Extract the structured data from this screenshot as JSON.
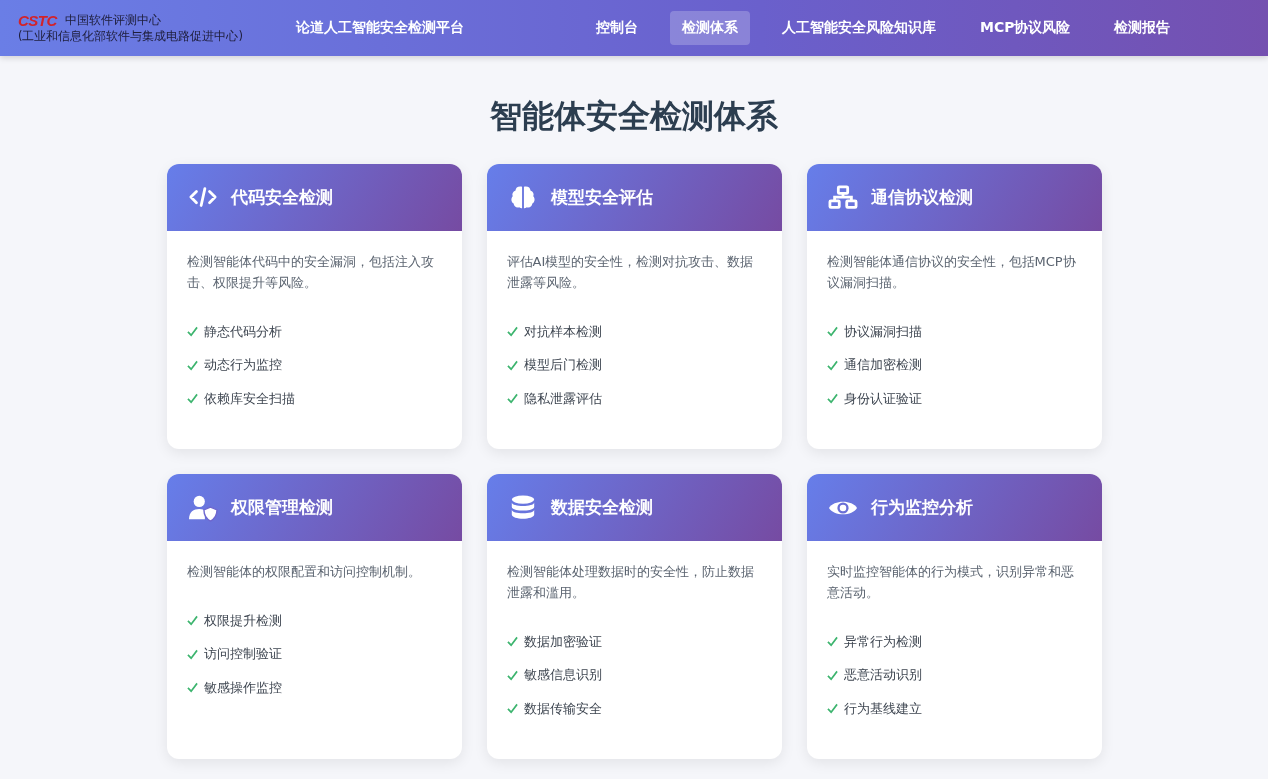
{
  "header": {
    "logo_mark": "CSTC",
    "logo_name": "中国软件评测中心",
    "logo_subtitle": "(工业和信息化部软件与集成电路促进中心)",
    "platform_title": "论道人工智能安全检测平台",
    "nav": [
      {
        "label": "控制台",
        "selected": false
      },
      {
        "label": "检测体系",
        "selected": true
      },
      {
        "label": "人工智能安全风险知识库",
        "selected": false
      },
      {
        "label": "MCP协议风险",
        "selected": false
      },
      {
        "label": "检测报告",
        "selected": false
      }
    ]
  },
  "page_title": "智能体安全检测体系",
  "cards": [
    {
      "title": "代码安全检测",
      "description": "检测智能体代码中的安全漏洞，包括注入攻击、权限提升等风险。",
      "features": [
        "静态代码分析",
        "动态行为监控",
        "依赖库安全扫描"
      ]
    },
    {
      "title": "模型安全评估",
      "description": "评估AI模型的安全性，检测对抗攻击、数据泄露等风险。",
      "features": [
        "对抗样本检测",
        "模型后门检测",
        "隐私泄露评估"
      ]
    },
    {
      "title": "通信协议检测",
      "description": "检测智能体通信协议的安全性，包括MCP协议漏洞扫描。",
      "features": [
        "协议漏洞扫描",
        "通信加密检测",
        "身份认证验证"
      ]
    },
    {
      "title": "权限管理检测",
      "description": "检测智能体的权限配置和访问控制机制。",
      "features": [
        "权限提升检测",
        "访问控制验证",
        "敏感操作监控"
      ]
    },
    {
      "title": "数据安全检测",
      "description": "检测智能体处理数据时的安全性，防止数据泄露和滥用。",
      "features": [
        "数据加密验证",
        "敏感信息识别",
        "数据传输安全"
      ]
    },
    {
      "title": "行为监控分析",
      "description": "实时监控智能体的行为模式，识别异常和恶意活动。",
      "features": [
        "异常行为检测",
        "恶意活动识别",
        "行为基线建立"
      ]
    }
  ]
}
